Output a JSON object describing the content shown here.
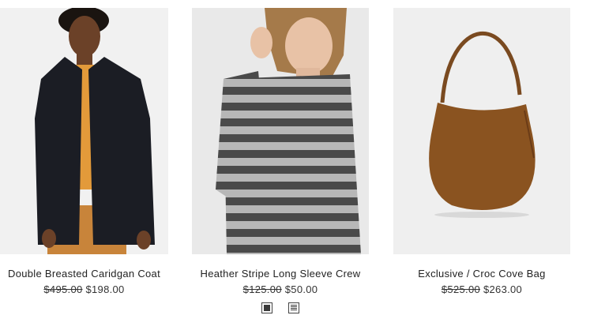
{
  "products": [
    {
      "name": "Double Breasted Caridgan Coat",
      "original_price": "$495.00",
      "sale_price": "$198.00",
      "image": "model-black-coat-orange-sweater-photo"
    },
    {
      "name": "Heather Stripe Long Sleeve Crew",
      "original_price": "$125.00",
      "sale_price": "$50.00",
      "image": "model-grey-stripe-tee-photo",
      "swatches": [
        {
          "name": "solid-charcoal-swatch",
          "color": "#3b3b3b"
        },
        {
          "name": "stripe-swatch",
          "color": "#3b3b3b"
        }
      ]
    },
    {
      "name": "Exclusive / Croc Cove Bag",
      "original_price": "$525.00",
      "sale_price": "$263.00",
      "image": "brown-suede-hobo-bag-photo"
    }
  ],
  "colors": {
    "image_background": "#efefef",
    "coat": "#1b1d24",
    "sweater": "#e39a3a",
    "stripe_dark": "#4a4a4a",
    "stripe_light": "#b7b7b7",
    "bag": "#8a5320"
  }
}
